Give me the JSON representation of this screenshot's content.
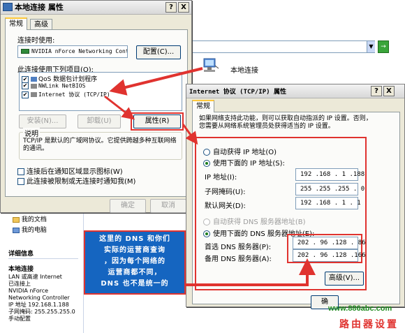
{
  "background_window": {
    "address_value": "",
    "local_connection_label": "本地连接",
    "left_panel": {
      "places": [
        "我的文档",
        "我的电脑"
      ],
      "details_heading": "详细信息",
      "details_name": "本地连接",
      "details_lines": [
        "LAN 或高速 Internet",
        "已连接上",
        "NVIDIA nForce",
        "Networking Controller",
        "IP 地址 192.168.1.188",
        "子网掩码: 255.255.255.0",
        "手动配置"
      ]
    }
  },
  "props_dialog": {
    "title": "本地连接 属性",
    "help_btn": "?",
    "close_btn": "X",
    "tabs": [
      "常规",
      "高级"
    ],
    "connect_using_label": "连接时使用:",
    "adapter_name": "NVIDIA nForce Networking Contr",
    "configure_btn": "配置(C)...",
    "items_label": "此连接使用下列项目(O):",
    "items": [
      {
        "label": "QoS 数据包计划程序",
        "checked": true
      },
      {
        "label": "NWLink NetBIOS",
        "checked": true
      },
      {
        "label": "Internet 协议 (TCP/IP)",
        "checked": true
      }
    ],
    "install_btn": "安装(N)...",
    "uninstall_btn": "卸载(U)",
    "properties_btn": "属性(R)",
    "description_label": "说明",
    "description_text": "TCP/IP 是默认的广域网协议。它提供跨越多种互联网络的通讯。",
    "show_icon_chk": "连接后在通知区域显示图标(W)",
    "notify_chk": "此连接被限制或无连接时通知我(M)",
    "ok_btn": "确定",
    "cancel_btn": "取消"
  },
  "tcpip_dialog": {
    "title": "Internet 协议 (TCP/IP) 属性",
    "help_btn": "?",
    "close_btn": "X",
    "tab": "常规",
    "intro": "如果网络支持此功能，则可以获取自动指派的 IP 设置。否则，您需要从网络系统管理员处获得适当的 IP 设置。",
    "auto_ip_radio": "自动获得 IP 地址(O)",
    "manual_ip_radio": "使用下面的 IP 地址(S):",
    "ip_label": "IP 地址(I):",
    "ip_value": "192 .168 . 1 .188",
    "mask_label": "子网掩码(U):",
    "mask_value": "255 .255 .255 . 0",
    "gateway_label": "默认网关(D):",
    "gateway_value": "192 .168 . 1 . 1",
    "auto_dns_radio": "自动获得 DNS 服务器地址(B)",
    "manual_dns_radio": "使用下面的 DNS 服务器地址(E):",
    "pref_dns_label": "首选 DNS 服务器(P):",
    "pref_dns_value": "202 . 96 .128 . 86",
    "alt_dns_label": "备用 DNS 服务器(A):",
    "alt_dns_value": "202 . 96 .128 .166",
    "advanced_btn": "高级(V)...",
    "ok_btn": "确"
  },
  "annotation": {
    "lines": [
      "这里的 DNS 和你们",
      "实际的运营商查询",
      "，因为每个网络的",
      "运营商都不同，",
      "DNS 也不是统一的"
    ]
  },
  "watermark": {
    "url": "www.886abc.com",
    "name": "路由器设置"
  },
  "colors": {
    "annotation_bg": "#1565c0",
    "annotation_border": "#e0332f",
    "arrow_red": "#e0332f"
  }
}
